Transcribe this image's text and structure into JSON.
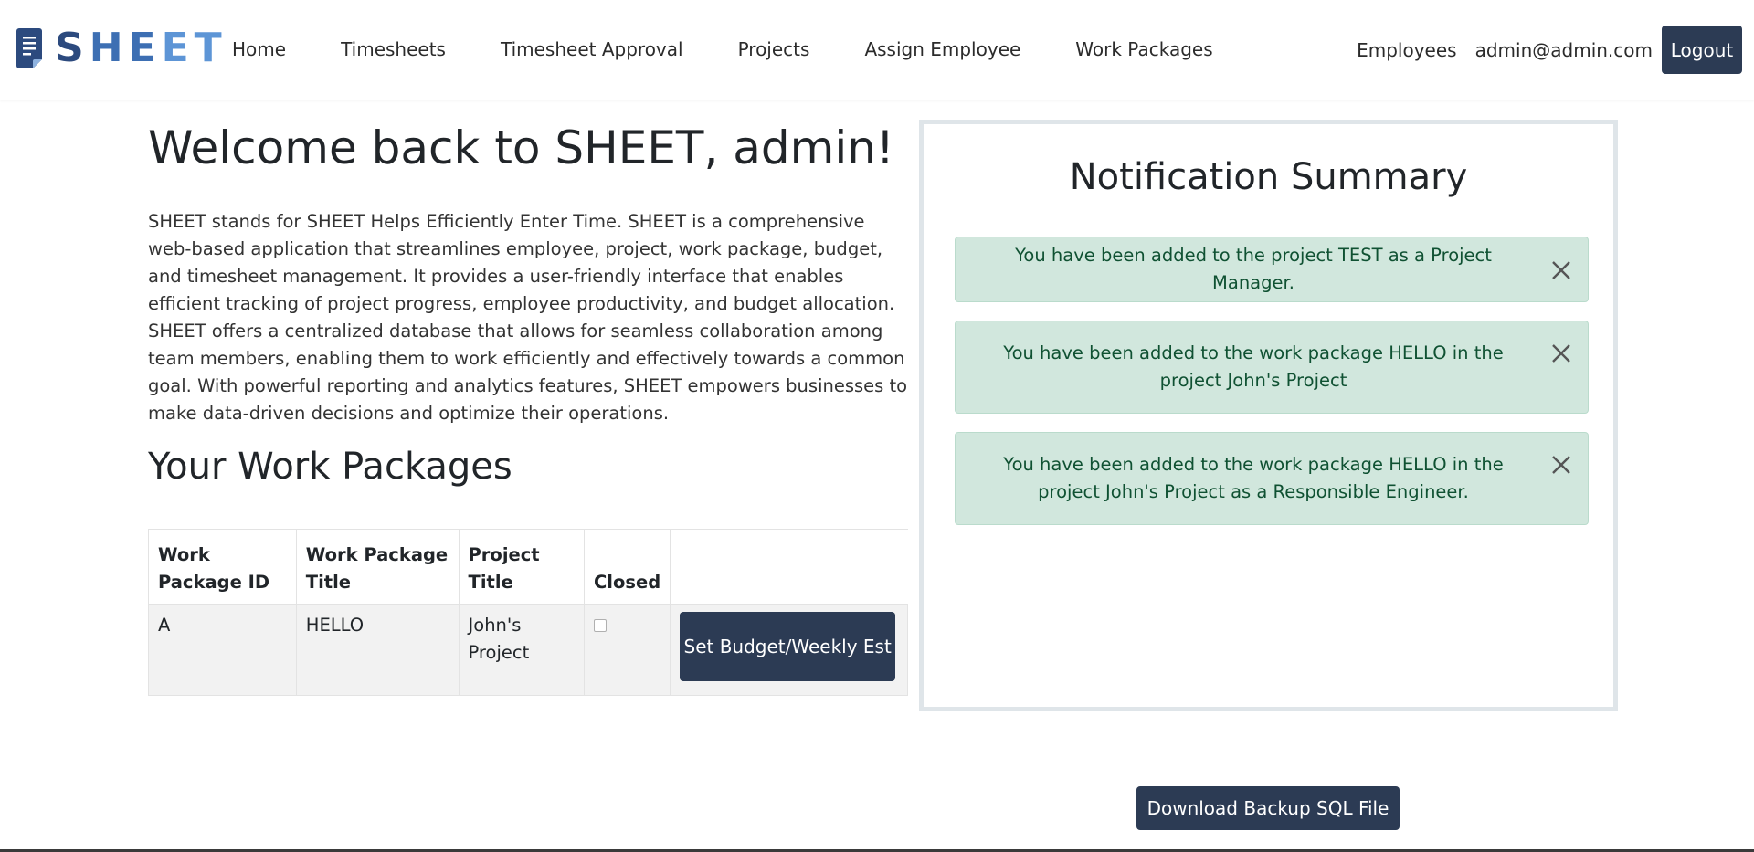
{
  "brand": {
    "part1": "S",
    "part2": "HE",
    "part3": "ET",
    "icon": "document-icon"
  },
  "nav": {
    "links": [
      "Home",
      "Timesheets",
      "Timesheet Approval",
      "Projects",
      "Assign Employee",
      "Work Packages"
    ],
    "employees": "Employees",
    "user_email": "admin@admin.com",
    "logout": "Logout"
  },
  "main": {
    "welcome": "Welcome back to SHEET, admin!",
    "intro": "SHEET stands for SHEET Helps Efficiently Enter Time. SHEET is a comprehensive web-based application that streamlines employee, project, work package, budget, and timesheet management. It provides a user-friendly interface that enables efficient tracking of project progress, employee productivity, and budget allocation. SHEET offers a centralized database that allows for seamless collaboration among team members, enabling them to work efficiently and effectively towards a common goal. With powerful reporting and analytics features, SHEET empowers businesses to make data-driven decisions and optimize their operations.",
    "wp_heading": "Your Work Packages"
  },
  "table": {
    "headers": [
      "Work Package ID",
      "Work Package Title",
      "Project Title",
      "Closed",
      ""
    ],
    "rows": [
      {
        "id": "A",
        "title": "HELLO",
        "project": "John's Project",
        "closed": false,
        "action": "Set Budget/Weekly Est"
      }
    ]
  },
  "notifications": {
    "title": "Notification Summary",
    "items": [
      "You have been added to the project TEST as a Project Manager.",
      "You have been added to the work package HELLO in the project John's Project",
      "You have been added to the work package HELLO in the project John's Project as a Responsible Engineer."
    ]
  },
  "download_label": "Download Backup SQL File",
  "colors": {
    "primary_button": "#2c3b54",
    "alert_bg": "#d1e7dd",
    "alert_text": "#0f5132",
    "brand_dark": "#2c4a7e",
    "brand_light": "#5d95d6"
  }
}
